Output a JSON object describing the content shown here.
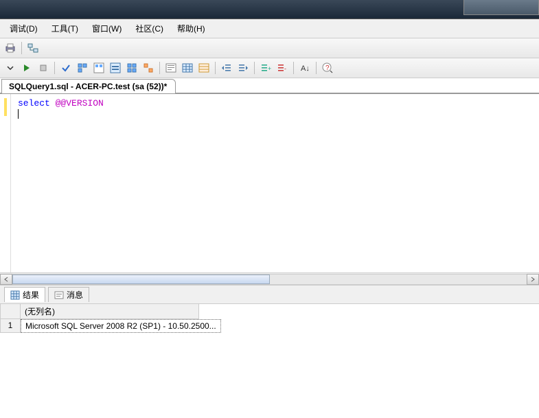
{
  "menus": {
    "debug": "调试(D)",
    "tools": "工具(T)",
    "window": "窗口(W)",
    "community": "社区(C)",
    "help": "帮助(H)"
  },
  "tab": {
    "title": "SQLQuery1.sql - ACER-PC.test (sa (52))*"
  },
  "code": {
    "keyword": "select",
    "variable": "@@VERSION"
  },
  "results_tabs": {
    "results": "结果",
    "messages": "消息"
  },
  "grid": {
    "header": "(无列名)",
    "rownum": "1",
    "cell": "Microsoft SQL Server 2008 R2 (SP1) - 10.50.2500..."
  },
  "colors": {
    "keyword": "#0000ff",
    "variable": "#c000c0"
  }
}
